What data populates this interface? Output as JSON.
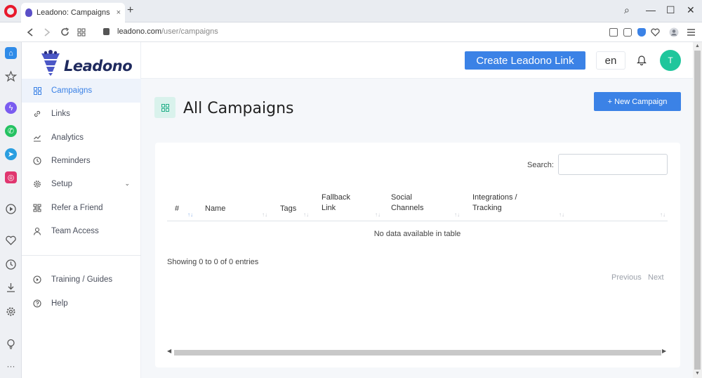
{
  "browser": {
    "tab_title": "Leadono: Campaigns",
    "tab_close": "×",
    "new_tab": "+",
    "url_host": "leadono.com",
    "url_path": "/user/campaigns",
    "controls": {
      "search": "⌕",
      "minimize": "—",
      "maximize": "☐",
      "close": "✕"
    }
  },
  "brand": {
    "name": "Leadono"
  },
  "sidebar": {
    "items": [
      {
        "label": "Campaigns",
        "icon": "grid-icon"
      },
      {
        "label": "Links",
        "icon": "link-icon"
      },
      {
        "label": "Analytics",
        "icon": "chart-icon"
      },
      {
        "label": "Reminders",
        "icon": "clock-icon"
      },
      {
        "label": "Setup",
        "icon": "gear-icon"
      },
      {
        "label": "Refer a Friend",
        "icon": "sitemap-icon"
      },
      {
        "label": "Team Access",
        "icon": "user-icon"
      },
      {
        "label": "Training / Guides",
        "icon": "play-circle-icon"
      },
      {
        "label": "Help",
        "icon": "help-circle-icon"
      }
    ],
    "setup_chevron": "⌄"
  },
  "topbar": {
    "create_link": "Create Leadono Link",
    "language": "en",
    "avatar_initial": "T"
  },
  "page": {
    "title": "All Campaigns",
    "new_campaign": "+ New Campaign"
  },
  "table": {
    "search_label": "Search:",
    "columns": {
      "num": "#",
      "name": "Name",
      "tags": "Tags",
      "fallback_1": "Fallback",
      "fallback_2": "Link",
      "social_1": "Social",
      "social_2": "Channels",
      "integ_1": "Integrations /",
      "integ_2": "Tracking"
    },
    "sort_glyph": "↑↓",
    "empty_message": "No data available in table",
    "info": "Showing 0 to 0 of 0 entries",
    "previous": "Previous",
    "next": "Next"
  },
  "colors": {
    "accent": "#3b82e6",
    "avatar": "#1fc69c",
    "active_bg": "#eef3fb"
  }
}
